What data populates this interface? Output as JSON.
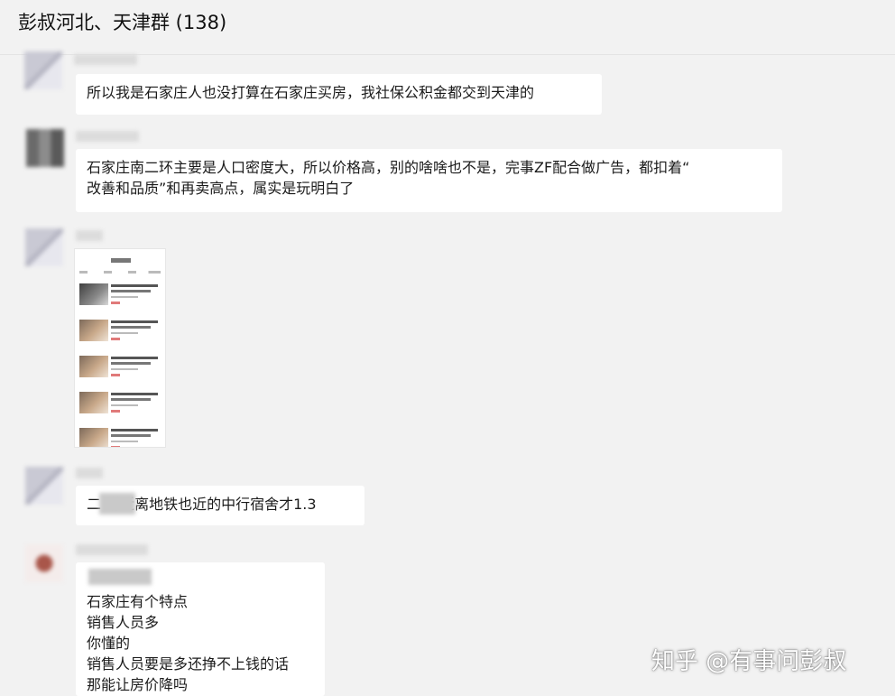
{
  "header": {
    "title": "彭叔河北、天津群 (138)"
  },
  "messages": [
    {
      "lines": [
        "所以我是石家庄人也没打算在石家庄买房，我社保公积金都交到天津的"
      ]
    },
    {
      "lines": [
        "石家庄南二环主要是人口密度大，所以价格高，别的啥啥也不是，完事ZF配合做广告，都扣着“",
        "改善和品质”和再卖高点，属实是玩明白了"
      ]
    },
    {
      "type": "image"
    },
    {
      "lines": [
        "二      附近离地铁也近的中行宿舍才1.3"
      ]
    },
    {
      "lines": [
        "石家庄有个特点",
        "销售人员多",
        "你懂的",
        "销售人员要是多还挣不上钱的话",
        "那能让房价降吗"
      ]
    }
  ],
  "watermark": "知乎 @有事问彭叔",
  "colors": {
    "background": "#f2f2f2",
    "bubble": "#ffffff"
  }
}
